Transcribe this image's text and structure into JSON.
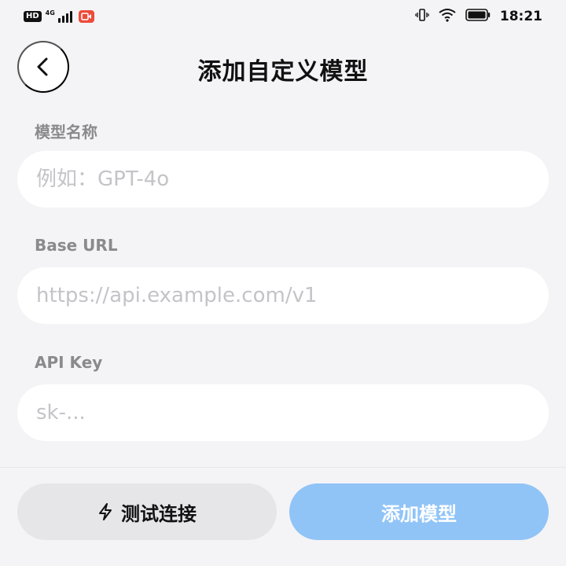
{
  "status_bar": {
    "hd": "HD",
    "network": "4G",
    "time": "18:21"
  },
  "header": {
    "title": "添加自定义模型"
  },
  "form": {
    "fields": [
      {
        "label": "模型名称",
        "placeholder": "例如：GPT-4o",
        "value": ""
      },
      {
        "label": "Base URL",
        "placeholder": "https://api.example.com/v1",
        "value": ""
      },
      {
        "label": "API Key",
        "placeholder": "sk-...",
        "value": ""
      }
    ]
  },
  "actions": {
    "test_label": "测试连接",
    "add_label": "添加模型"
  },
  "colors": {
    "background": "#f4f4f6",
    "primary_disabled": "#90c4f7",
    "secondary_button": "#e6e6e9",
    "label": "#8a8a8e",
    "placeholder": "#c4c4c8"
  },
  "icons": {
    "back": "chevron-left-icon",
    "test": "lightning-icon"
  }
}
